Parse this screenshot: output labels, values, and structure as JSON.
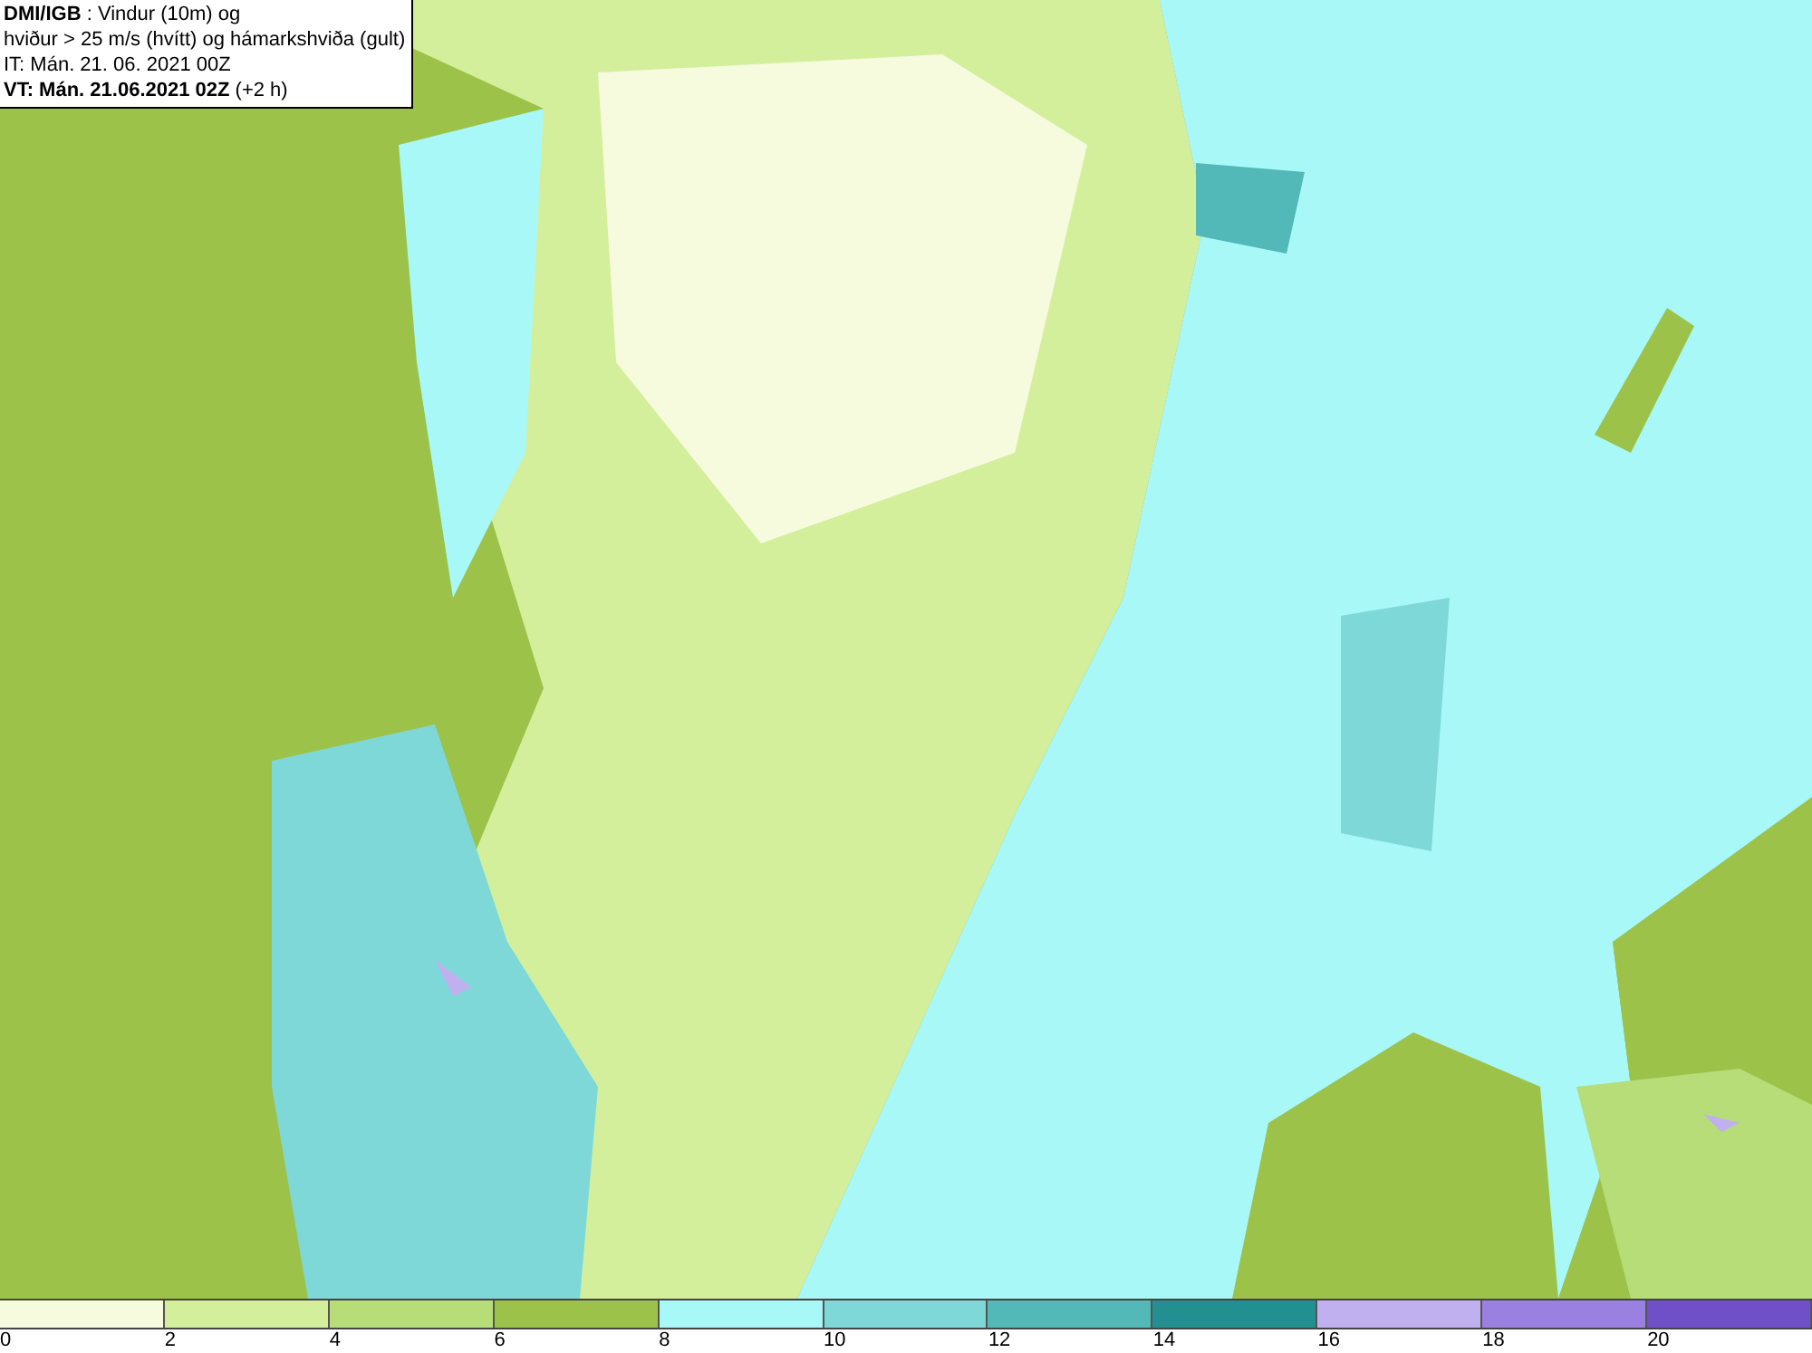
{
  "info_box": {
    "lines": [
      "**DMI/IGB** : Vindur (10m) og",
      "hviður > 25 m/s (hvítt) og hámarkshviða (gult)",
      "IT: Mán. 21. 06. 2021 00Z",
      "**VT: Mán. 21.06.2021 02Z** (+2 h)"
    ]
  },
  "legend": [
    {
      "label": "0",
      "color": "#f5fbdc"
    },
    {
      "label": "2",
      "color": "#d4ef9c"
    },
    {
      "label": "4",
      "color": "#b6dd78"
    },
    {
      "label": "6",
      "color": "#9cc24a"
    },
    {
      "label": "8",
      "color": "#a8f8f8"
    },
    {
      "label": "10",
      "color": "#7fd8d8"
    },
    {
      "label": "12",
      "color": "#52b8b8"
    },
    {
      "label": "14",
      "color": "#229090"
    },
    {
      "label": "16",
      "color": "#c0b0f0"
    },
    {
      "label": "18",
      "color": "#9a80e0"
    },
    {
      "label": "20",
      "color": "#7050c8"
    }
  ]
}
